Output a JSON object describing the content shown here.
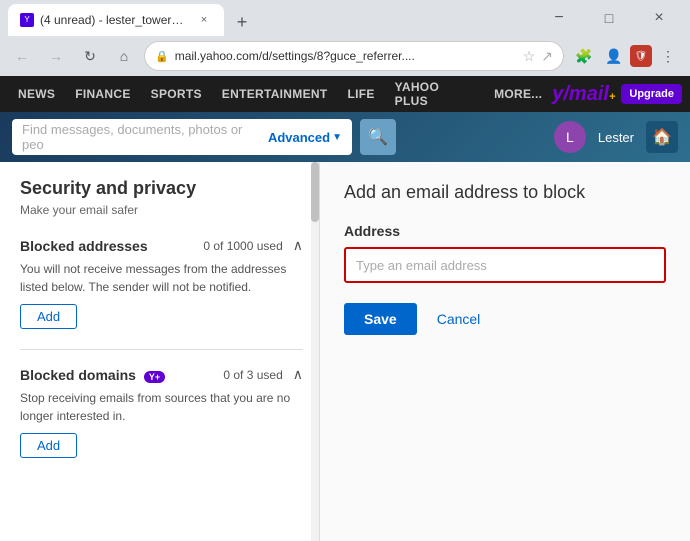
{
  "browser": {
    "tab": {
      "title": "(4 unread) - lester_tower@yaho...",
      "favicon": "Y"
    },
    "new_tab_label": "+",
    "address": "mail.yahoo.com/d/settings/8?guce_referrer....",
    "window_controls": {
      "minimize": "−",
      "maximize": "□",
      "close": "×"
    }
  },
  "nav": {
    "items": [
      {
        "label": "NEWS"
      },
      {
        "label": "FINANCE"
      },
      {
        "label": "SPORTS"
      },
      {
        "label": "ENTERTAINMENT"
      },
      {
        "label": "LIFE"
      },
      {
        "label": "YAHOO PLUS"
      },
      {
        "label": "MORE..."
      }
    ],
    "logo": "y/mail",
    "upgrade_label": "Upgrade"
  },
  "searchbar": {
    "placeholder": "Find messages, documents, photos or peo",
    "advanced_label": "Advanced",
    "user_name": "Lester"
  },
  "left_panel": {
    "title": "Security and privacy",
    "subtitle": "Make your email safer",
    "sections": [
      {
        "id": "blocked-addresses",
        "title": "Blocked addresses",
        "description": "You will not receive messages from the addresses listed below. The sender will not be notified.",
        "usage": "0 of 1000 used",
        "add_label": "Add"
      },
      {
        "id": "blocked-domains",
        "title": "Blocked domains",
        "description": "Stop receiving emails from sources that you are no longer interested in.",
        "usage": "0 of 3 used",
        "add_label": "Add",
        "has_plus": true
      }
    ]
  },
  "right_panel": {
    "title": "Add an email address to block",
    "field_label": "Address",
    "input_placeholder": "Type an email address",
    "save_label": "Save",
    "cancel_label": "Cancel"
  }
}
